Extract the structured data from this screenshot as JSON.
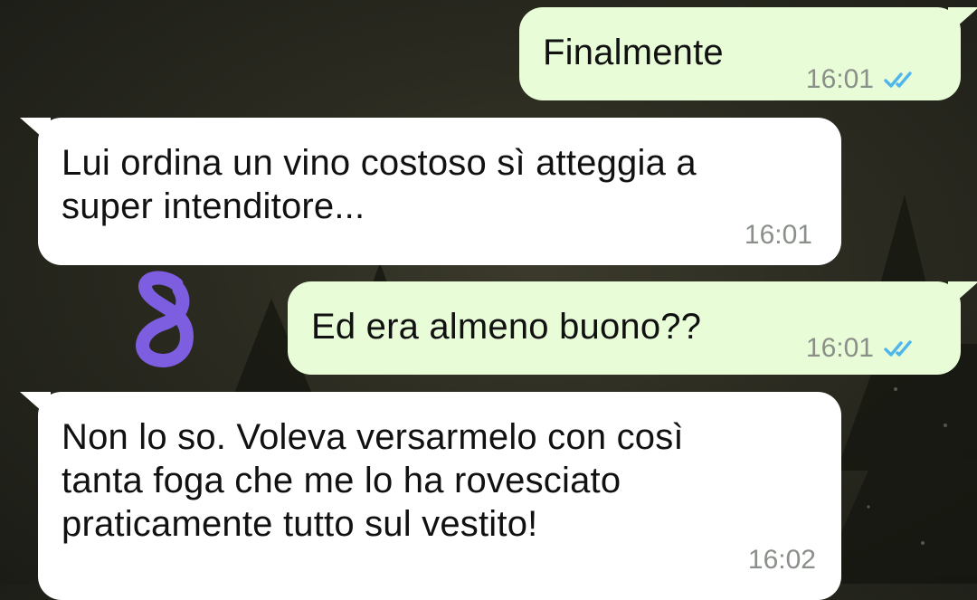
{
  "messages": [
    {
      "direction": "outgoing",
      "text": "Finalmente",
      "time": "16:01",
      "status": "read",
      "status_icon": "double-check-icon"
    },
    {
      "direction": "incoming",
      "text": "Lui ordina un vino costoso sì atteggia a\nsuper intenditore...",
      "time": "16:01"
    },
    {
      "direction": "outgoing",
      "text": "Ed era almeno buono??",
      "time": "16:01",
      "status": "read",
      "status_icon": "double-check-icon"
    },
    {
      "direction": "incoming",
      "text": "Non lo so. Voleva versarmelo con così\ntanta foga che me lo ha rovesciato\npraticamente tutto sul vestito!",
      "time": "16:02"
    }
  ],
  "annotation": {
    "icon": "scribble-annotation-icon",
    "color": "#7d5ee0"
  },
  "colors": {
    "outgoing_bubble": "#e8fcd8",
    "incoming_bubble": "#ffffff",
    "read_ticks": "#4fb6ec",
    "timestamp": "#8a9089"
  }
}
